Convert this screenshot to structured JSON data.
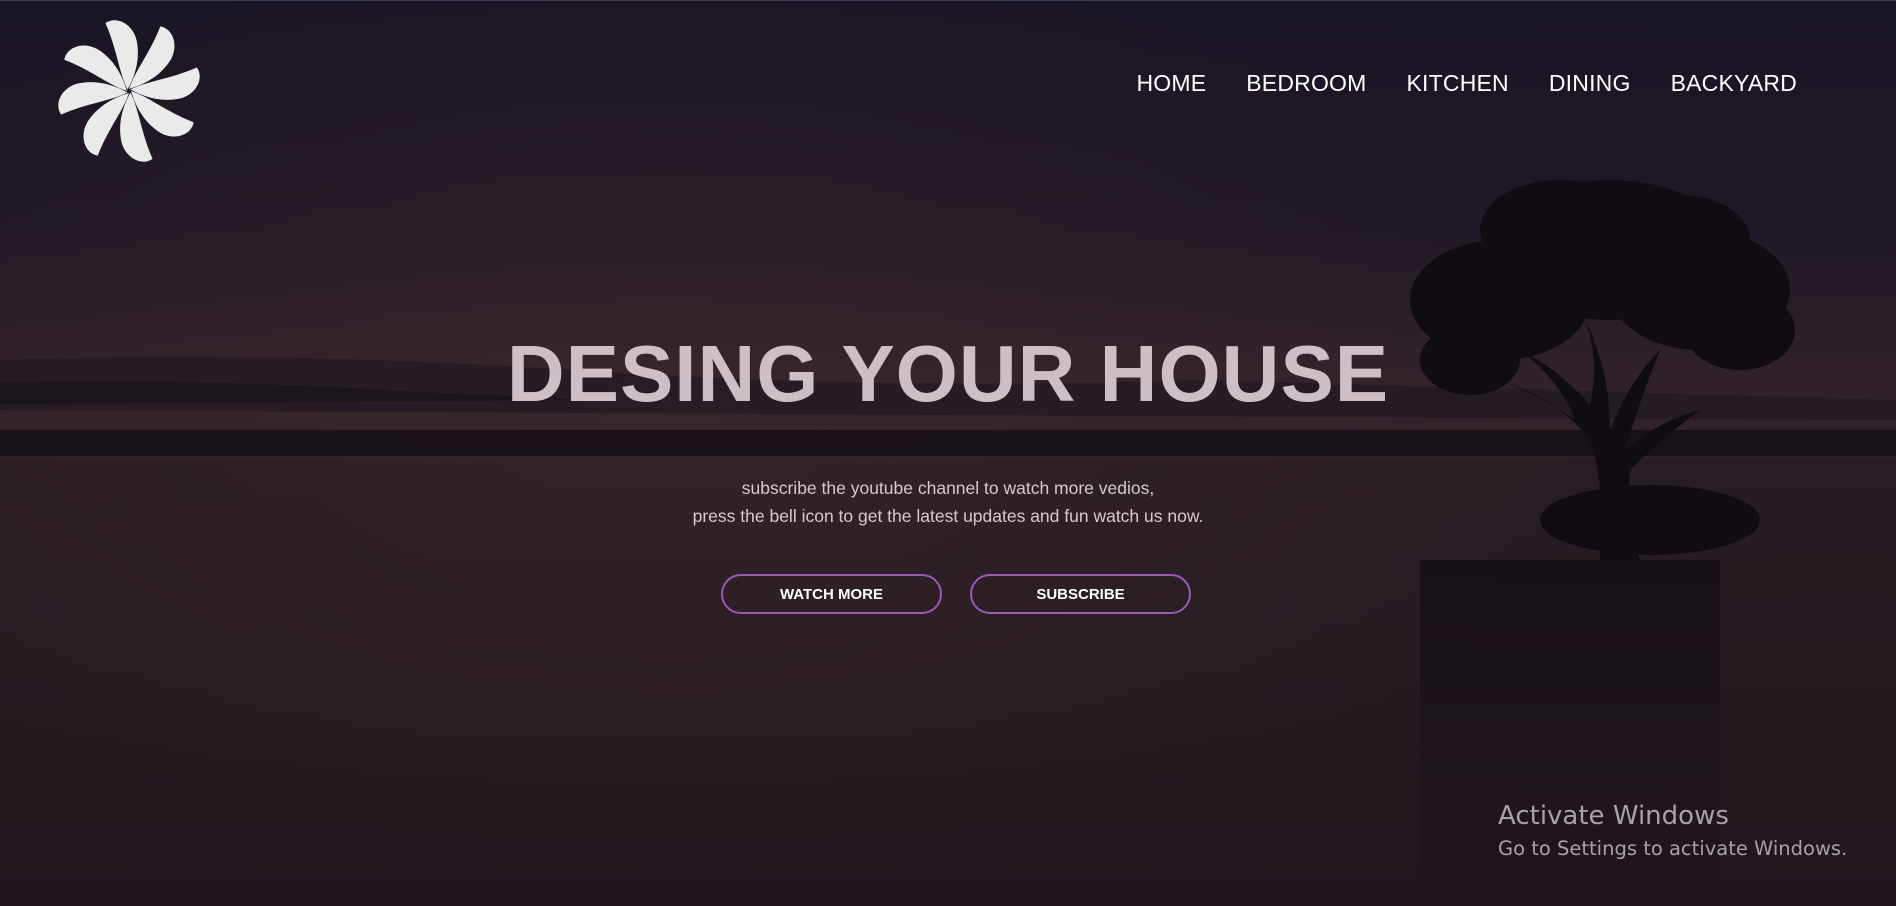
{
  "nav": {
    "items": [
      {
        "label": "HOME"
      },
      {
        "label": "BEDROOM"
      },
      {
        "label": "KITCHEN"
      },
      {
        "label": "DINING"
      },
      {
        "label": "BACKYARD"
      }
    ]
  },
  "hero": {
    "title": "DESING YOUR HOUSE",
    "subtitle_line1": "subscribe the youtube channel to watch more vedios,",
    "subtitle_line2": "press the bell icon to get the latest updates and fun watch us now."
  },
  "buttons": {
    "watch_more": "WATCH MORE",
    "subscribe": "SUBSCRIBE"
  },
  "watermark": {
    "title": "Activate Windows",
    "subtitle": "Go to Settings to activate Windows."
  },
  "colors": {
    "button_border": "#9b5ab6",
    "title_text": "#cdbfc6",
    "nav_text": "#ffffff",
    "background_top": "#1e1a2a",
    "background_bottom": "#2a1e20"
  },
  "icons": {
    "logo": "pinwheel-icon"
  }
}
